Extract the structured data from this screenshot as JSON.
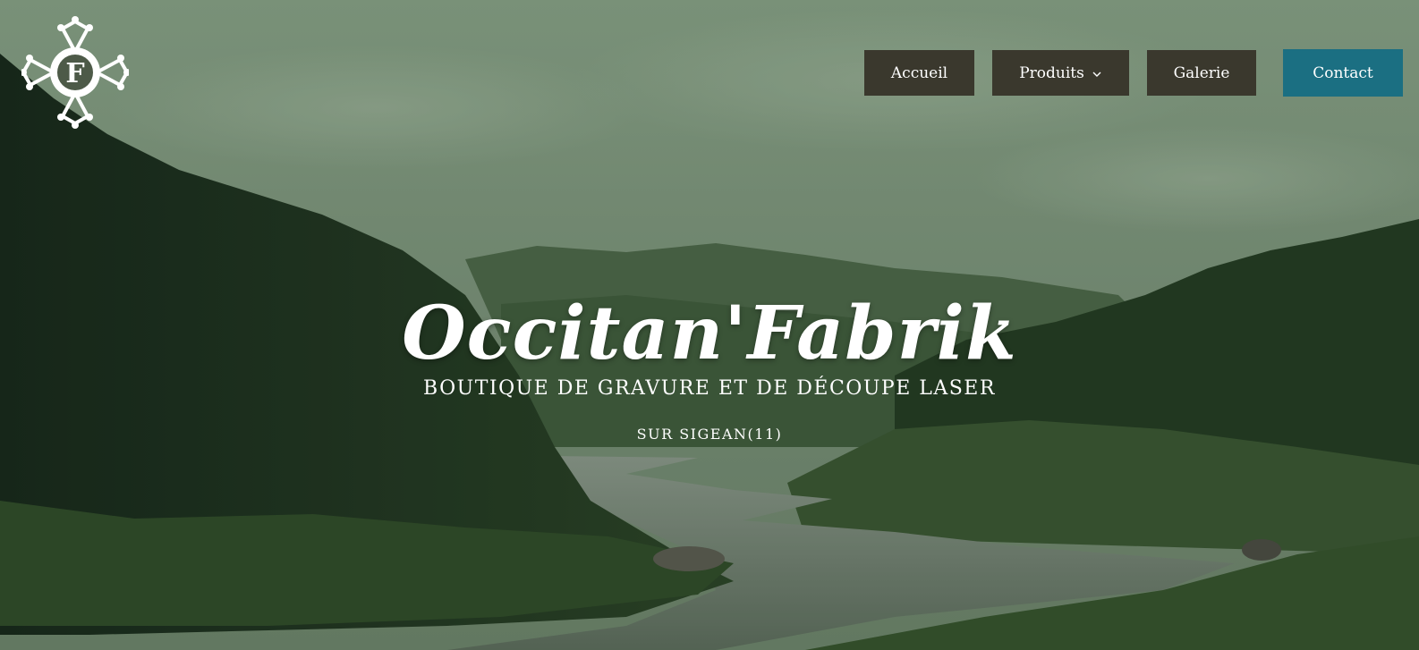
{
  "logo": {
    "letter": "F",
    "alt_icon": "occitan-cross-icon"
  },
  "nav": {
    "items": [
      {
        "label": "Accueil"
      },
      {
        "label": "Produits",
        "icon": "chevron-down-icon"
      },
      {
        "label": "Galerie"
      },
      {
        "label": "Contact"
      }
    ]
  },
  "hero": {
    "title": "Occitan'Fabrik",
    "subtitle": "BOUTIQUE DE GRAVURE ET DE DÉCOUPE LASER",
    "location": "SUR SIGEAN(11)"
  },
  "colors": {
    "nav_bg": "#3a382d",
    "contact_bg": "#1b6f82",
    "text": "#ffffff",
    "sky": "#7f957c",
    "forest": "#22361f",
    "river": "#6f7c6d"
  }
}
